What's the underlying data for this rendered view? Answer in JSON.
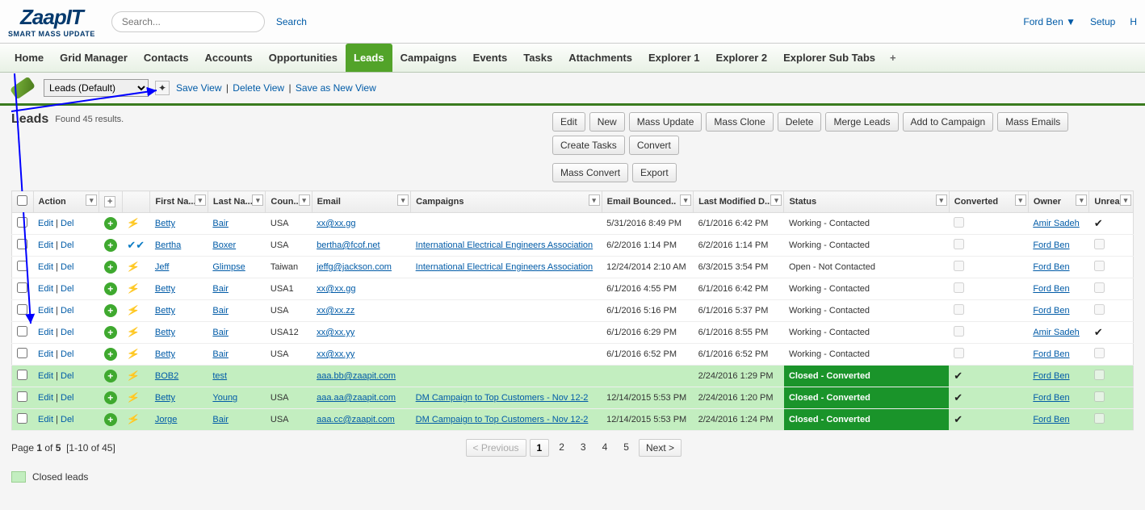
{
  "brand": {
    "main": "ZaapIT",
    "sub": "SMART MASS UPDATE"
  },
  "search": {
    "placeholder": "Search...",
    "button": "Search"
  },
  "user": {
    "name": "Ford Ben",
    "setup": "Setup",
    "help": "H"
  },
  "nav": [
    "Home",
    "Grid Manager",
    "Contacts",
    "Accounts",
    "Opportunities",
    "Leads",
    "Campaigns",
    "Events",
    "Tasks",
    "Attachments",
    "Explorer 1",
    "Explorer 2",
    "Explorer Sub Tabs"
  ],
  "nav_active": 5,
  "view": {
    "selected": "Leads (Default)",
    "save": "Save View",
    "delete": "Delete View",
    "saveas": "Save as New View"
  },
  "page": {
    "title": "Leads",
    "results": "Found 45 results."
  },
  "buttons_row1": [
    "Edit",
    "New",
    "Mass Update",
    "Mass Clone",
    "Delete",
    "Merge Leads",
    "Add to Campaign",
    "Mass Emails",
    "Create Tasks",
    "Convert"
  ],
  "buttons_row2": [
    "Mass Convert",
    "Export"
  ],
  "columns": [
    "",
    "Action",
    "",
    "",
    "First Na...",
    "Last Na...",
    "Coun...",
    "Email",
    "Campaigns",
    "Email Bounced..",
    "Last Modified D...",
    "Status",
    "Converted",
    "Owner",
    "Unrea..."
  ],
  "rows": [
    {
      "first": "Betty",
      "last": "Bair",
      "country": "USA",
      "email": "xx@xx.gg",
      "camp": "",
      "bounced": "5/31/2016 8:49 PM",
      "mod": "6/1/2016 6:42 PM",
      "status": "Working - Contacted",
      "conv": false,
      "owner": "Amir Sadeh",
      "unread": true,
      "doublecheck": false,
      "highlighted": false
    },
    {
      "first": "Bertha",
      "last": "Boxer",
      "country": "USA",
      "email": "bertha@fcof.net",
      "camp": "International Electrical Engineers Association",
      "bounced": "6/2/2016 1:14 PM",
      "mod": "6/2/2016 1:14 PM",
      "status": "Working - Contacted",
      "conv": false,
      "owner": "Ford Ben",
      "unread": false,
      "doublecheck": true,
      "highlighted": false
    },
    {
      "first": "Jeff",
      "last": "Glimpse",
      "country": "Taiwan",
      "email": "jeffg@jackson.com",
      "camp": "International Electrical Engineers Association",
      "bounced": "12/24/2014 2:10 AM",
      "mod": "6/3/2015 3:54 PM",
      "status": "Open - Not Contacted",
      "conv": false,
      "owner": "Ford Ben",
      "unread": false,
      "doublecheck": false,
      "highlighted": false
    },
    {
      "first": "Betty",
      "last": "Bair",
      "country": "USA1",
      "email": "xx@xx.gg",
      "camp": "",
      "bounced": "6/1/2016 4:55 PM",
      "mod": "6/1/2016 6:42 PM",
      "status": "Working - Contacted",
      "conv": false,
      "owner": "Ford Ben",
      "unread": false,
      "doublecheck": false,
      "highlighted": false
    },
    {
      "first": "Betty",
      "last": "Bair",
      "country": "USA",
      "email": "xx@xx.zz",
      "camp": "",
      "bounced": "6/1/2016 5:16 PM",
      "mod": "6/1/2016 5:37 PM",
      "status": "Working - Contacted",
      "conv": false,
      "owner": "Ford Ben",
      "unread": false,
      "doublecheck": false,
      "highlighted": false
    },
    {
      "first": "Betty",
      "last": "Bair",
      "country": "USA12",
      "email": "xx@xx.yy",
      "camp": "",
      "bounced": "6/1/2016 6:29 PM",
      "mod": "6/1/2016 8:55 PM",
      "status": "Working - Contacted",
      "conv": false,
      "owner": "Amir Sadeh",
      "unread": true,
      "doublecheck": false,
      "highlighted": false
    },
    {
      "first": "Betty",
      "last": "Bair",
      "country": "USA",
      "email": "xx@xx.yy",
      "camp": "",
      "bounced": "6/1/2016 6:52 PM",
      "mod": "6/1/2016 6:52 PM",
      "status": "Working - Contacted",
      "conv": false,
      "owner": "Ford Ben",
      "unread": false,
      "doublecheck": false,
      "highlighted": false
    },
    {
      "first": "BOB2",
      "last": "test",
      "country": "",
      "email": "aaa.bb@zaapit.com",
      "camp": "",
      "bounced": "",
      "mod": "2/24/2016 1:29 PM",
      "status": "Closed - Converted",
      "conv": true,
      "owner": "Ford Ben",
      "unread": false,
      "doublecheck": false,
      "highlighted": true
    },
    {
      "first": "Betty",
      "last": "Young",
      "country": "USA",
      "email": "aaa.aa@zaapit.com",
      "camp": "DM Campaign to Top Customers - Nov 12-2",
      "bounced": "12/14/2015 5:53 PM",
      "mod": "2/24/2016 1:20 PM",
      "status": "Closed - Converted",
      "conv": true,
      "owner": "Ford Ben",
      "unread": false,
      "doublecheck": false,
      "highlighted": true
    },
    {
      "first": "Jorge",
      "last": "Bair",
      "country": "USA",
      "email": "aaa.cc@zaapit.com",
      "camp": "DM Campaign to Top Customers - Nov 12-2",
      "bounced": "12/14/2015 5:53 PM",
      "mod": "2/24/2016 1:24 PM",
      "status": "Closed - Converted",
      "conv": true,
      "owner": "Ford Ben",
      "unread": false,
      "doublecheck": false,
      "highlighted": true
    }
  ],
  "actions": {
    "edit": "Edit",
    "del": "Del"
  },
  "pager": {
    "info": "Page 1 of 5  [1-10 of 45]",
    "prev": "< Previous",
    "next": "Next >",
    "pages": [
      "1",
      "2",
      "3",
      "4",
      "5"
    ],
    "current": 0
  },
  "legend": {
    "closed": "Closed leads"
  }
}
